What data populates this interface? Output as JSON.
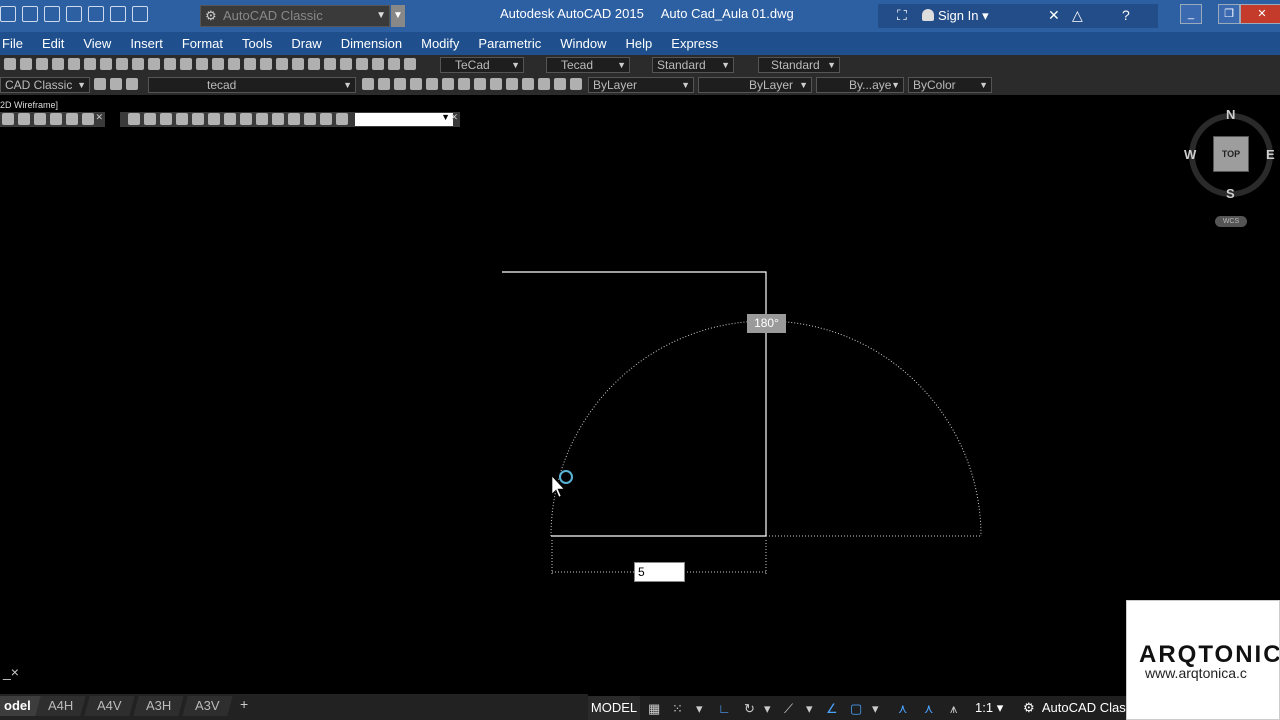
{
  "titlebar": {
    "workspace": "AutoCAD Classic",
    "app_title": "Autodesk AutoCAD 2015",
    "file_name": "Auto Cad_Aula 01.dwg",
    "sign_in": "Sign In"
  },
  "menu": [
    "File",
    "Edit",
    "View",
    "Insert",
    "Format",
    "Tools",
    "Draw",
    "Dimension",
    "Modify",
    "Parametric",
    "Window",
    "Help",
    "Express"
  ],
  "toolbar": {
    "text_style": "TeCad",
    "dim_style": "Tecad",
    "table_style": "Standard",
    "mleader_style": "Standard",
    "workspace_combo": "CAD Classic",
    "layer": "tecad",
    "color": "ByLayer",
    "linetype": "ByLayer",
    "lineweight": "By...aye",
    "plotstyle": "ByColor"
  },
  "viewport": {
    "label": "2D Wireframe]",
    "angle_tooltip": "180°",
    "dynamic_input": "5"
  },
  "viewcube": {
    "top": "TOP",
    "north": "N",
    "south": "S",
    "east": "E",
    "west": "W",
    "wcs": "WCS"
  },
  "command_line": {
    "close": "×"
  },
  "tabs": [
    {
      "label": "odel",
      "active": true
    },
    {
      "label": "A4H"
    },
    {
      "label": "A4V"
    },
    {
      "label": "A3H"
    },
    {
      "label": "A3V"
    }
  ],
  "tab_add": "+",
  "status": {
    "model": "MODEL",
    "annotation_scale": "1:1",
    "workspace": "AutoCAD Class"
  },
  "watermark": {
    "brand": "ARQTONIC",
    "url": "www.arqtonica.c"
  },
  "colors": {
    "titlebar": "#2d5fa3",
    "menubar": "#1f4f8d",
    "canvas": "#000000",
    "cursor_ring": "#5ab4d6"
  }
}
